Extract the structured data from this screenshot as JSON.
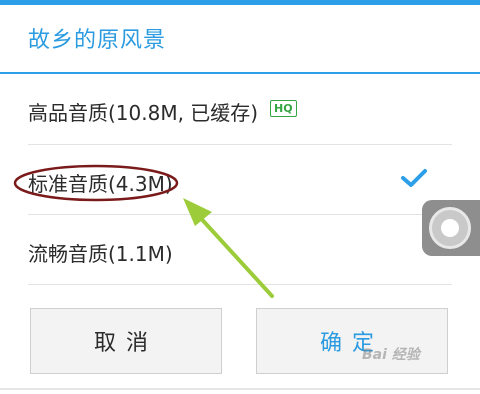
{
  "dialog": {
    "title": "故乡的原风景",
    "options": [
      {
        "label": "高品音质(10.8M, 已缓存)",
        "badge": "HQ",
        "selected": false
      },
      {
        "label": "标准音质(4.3M)",
        "selected": true
      },
      {
        "label": "流畅音质(1.1M)",
        "selected": false
      }
    ],
    "cancel_label": "取消",
    "ok_label": "确定"
  },
  "watermark": "Bai 经验",
  "colors": {
    "accent": "#2d9fe8",
    "hq_badge": "#35a742",
    "annotation_ellipse": "#7a1a1a",
    "annotation_arrow": "#9ccc3a"
  },
  "icons": {
    "check": "check-icon",
    "assistive_touch": "assistive-touch-icon"
  }
}
